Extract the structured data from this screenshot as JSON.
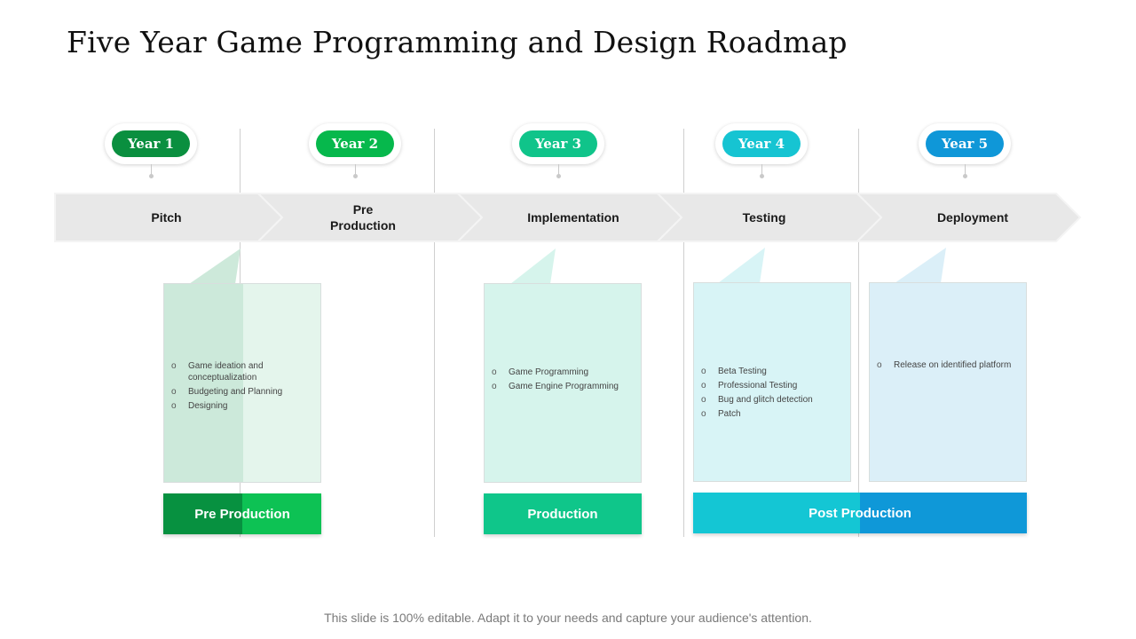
{
  "title": "Five Year Game Programming and Design Roadmap",
  "years": [
    {
      "label": "Year 1",
      "color": "#0a8f3f"
    },
    {
      "label": "Year 2",
      "color": "#06b84c"
    },
    {
      "label": "Year 3",
      "color": "#10c48a"
    },
    {
      "label": "Year 4",
      "color": "#16c4d2"
    },
    {
      "label": "Year 5",
      "color": "#0f97d8"
    }
  ],
  "stages": [
    {
      "label": "Pitch"
    },
    {
      "label": "Pre\nProduction"
    },
    {
      "label": "Implementation"
    },
    {
      "label": "Testing"
    },
    {
      "label": "Deployment"
    }
  ],
  "cards": [
    {
      "items": [
        "Game ideation and conceptualization",
        "Budgeting and Planning",
        "Designing"
      ]
    },
    {
      "items": [
        "Game Programming",
        "Game Engine Programming"
      ]
    },
    {
      "items": [
        "Beta Testing",
        "Professional Testing",
        "Bug and glitch detection",
        "Patch"
      ]
    },
    {
      "items": [
        "Release on identified platform"
      ]
    }
  ],
  "bullet_glyph": "o",
  "phases": [
    {
      "label": "Pre Production",
      "color_left": "#079140",
      "color_right": "#0dc254"
    },
    {
      "label": "Production",
      "color_left": "#0fc68a",
      "color_right": "#0fc68a"
    },
    {
      "label": "Post Production",
      "color_left": "#14c6d4",
      "color_right": "#0f98d8"
    }
  ],
  "footer": "This slide is 100% editable. Adapt it to your needs and capture your audience's attention."
}
